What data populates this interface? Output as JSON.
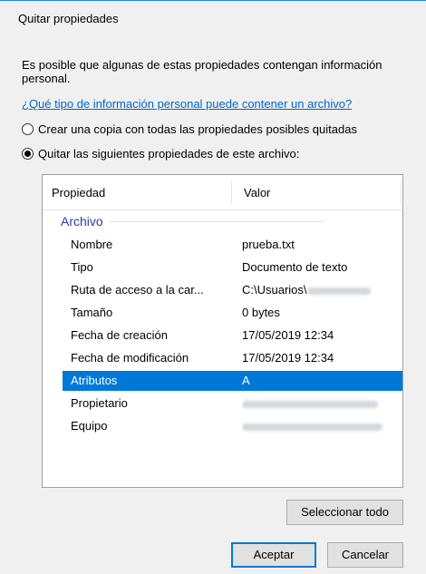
{
  "dialog": {
    "title": "Quitar propiedades",
    "description": "Es posible que algunas de estas propiedades contengan información personal.",
    "link": "¿Qué tipo de información personal puede contener un archivo?",
    "option_copy": "Crear una copia con todas las propiedades posibles quitadas",
    "option_remove": "Quitar las siguientes propiedades de este archivo:",
    "selected_option": "option_remove"
  },
  "table": {
    "col_property": "Propiedad",
    "col_value": "Valor",
    "group": "Archivo",
    "rows": [
      {
        "property": "Nombre",
        "value": "prueba.txt"
      },
      {
        "property": "Tipo",
        "value": "Documento de texto"
      },
      {
        "property": "Ruta de acceso a la car...",
        "value": "C:\\Usuarios\\"
      },
      {
        "property": "Tamaño",
        "value": "0 bytes"
      },
      {
        "property": "Fecha de creación",
        "value": "17/05/2019 12:34"
      },
      {
        "property": "Fecha de modificación",
        "value": "17/05/2019 12:34"
      },
      {
        "property": "Atributos",
        "value": "A"
      },
      {
        "property": "Propietario",
        "value": ""
      },
      {
        "property": "Equipo",
        "value": ""
      }
    ],
    "selected_row": "Atributos"
  },
  "buttons": {
    "select_all": "Seleccionar todo",
    "accept": "Aceptar",
    "cancel": "Cancelar"
  },
  "colors": {
    "selection": "#0078d7",
    "link": "#0066cc",
    "group_title": "#1e3fa8"
  }
}
